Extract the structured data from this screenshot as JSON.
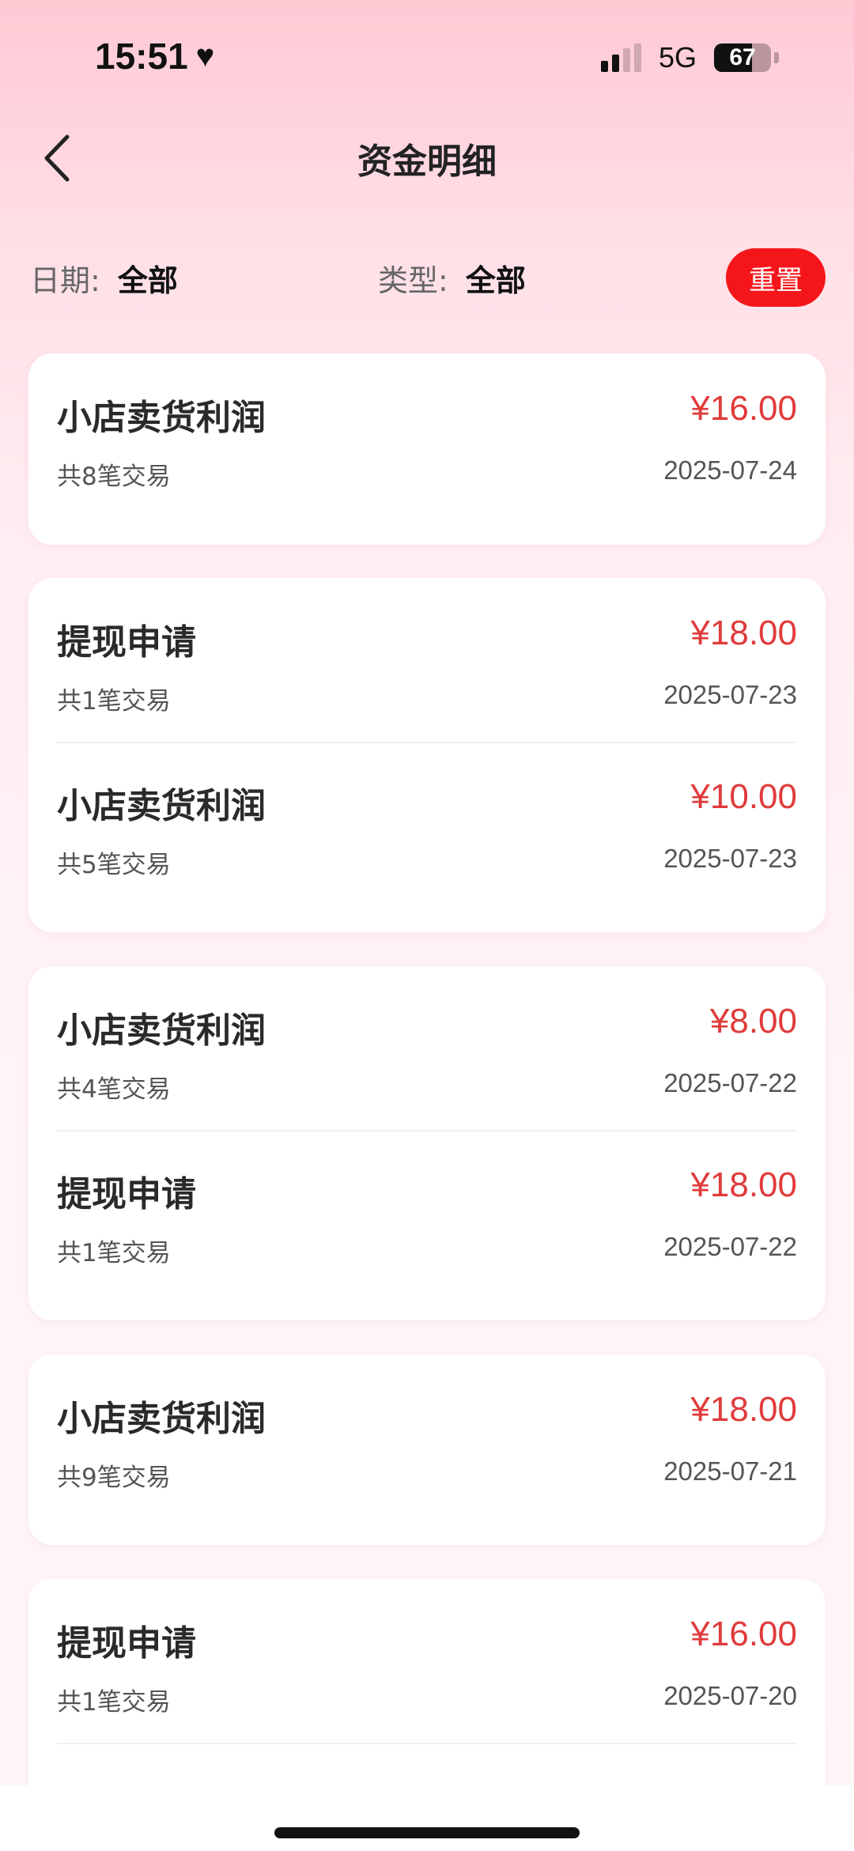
{
  "status_bar": {
    "time": "15:51",
    "network": "5G",
    "battery_level": "67",
    "battery_fraction": 0.67
  },
  "nav": {
    "title": "资金明细",
    "back_icon": "chevron-left-icon"
  },
  "filters": {
    "date_label": "日期",
    "date_value": "全部",
    "type_label": "类型",
    "type_value": "全部",
    "separator": ":",
    "reset_label": "重置"
  },
  "colors": {
    "accent_red": "#f5161b",
    "amount_red": "#e03b3b"
  },
  "groups": [
    {
      "records": [
        {
          "title": "小店卖货利润",
          "amount": "¥16.00",
          "count": "共8笔交易",
          "date": "2025-07-24"
        }
      ]
    },
    {
      "records": [
        {
          "title": "提现申请",
          "amount": "¥18.00",
          "count": "共1笔交易",
          "date": "2025-07-23"
        },
        {
          "title": "小店卖货利润",
          "amount": "¥10.00",
          "count": "共5笔交易",
          "date": "2025-07-23"
        }
      ]
    },
    {
      "records": [
        {
          "title": "小店卖货利润",
          "amount": "¥8.00",
          "count": "共4笔交易",
          "date": "2025-07-22"
        },
        {
          "title": "提现申请",
          "amount": "¥18.00",
          "count": "共1笔交易",
          "date": "2025-07-22"
        }
      ]
    },
    {
      "records": [
        {
          "title": "小店卖货利润",
          "amount": "¥18.00",
          "count": "共9笔交易",
          "date": "2025-07-21"
        }
      ]
    },
    {
      "records": [
        {
          "title": "提现申请",
          "amount": "¥16.00",
          "count": "共1笔交易",
          "date": "2025-07-20"
        }
      ]
    }
  ]
}
